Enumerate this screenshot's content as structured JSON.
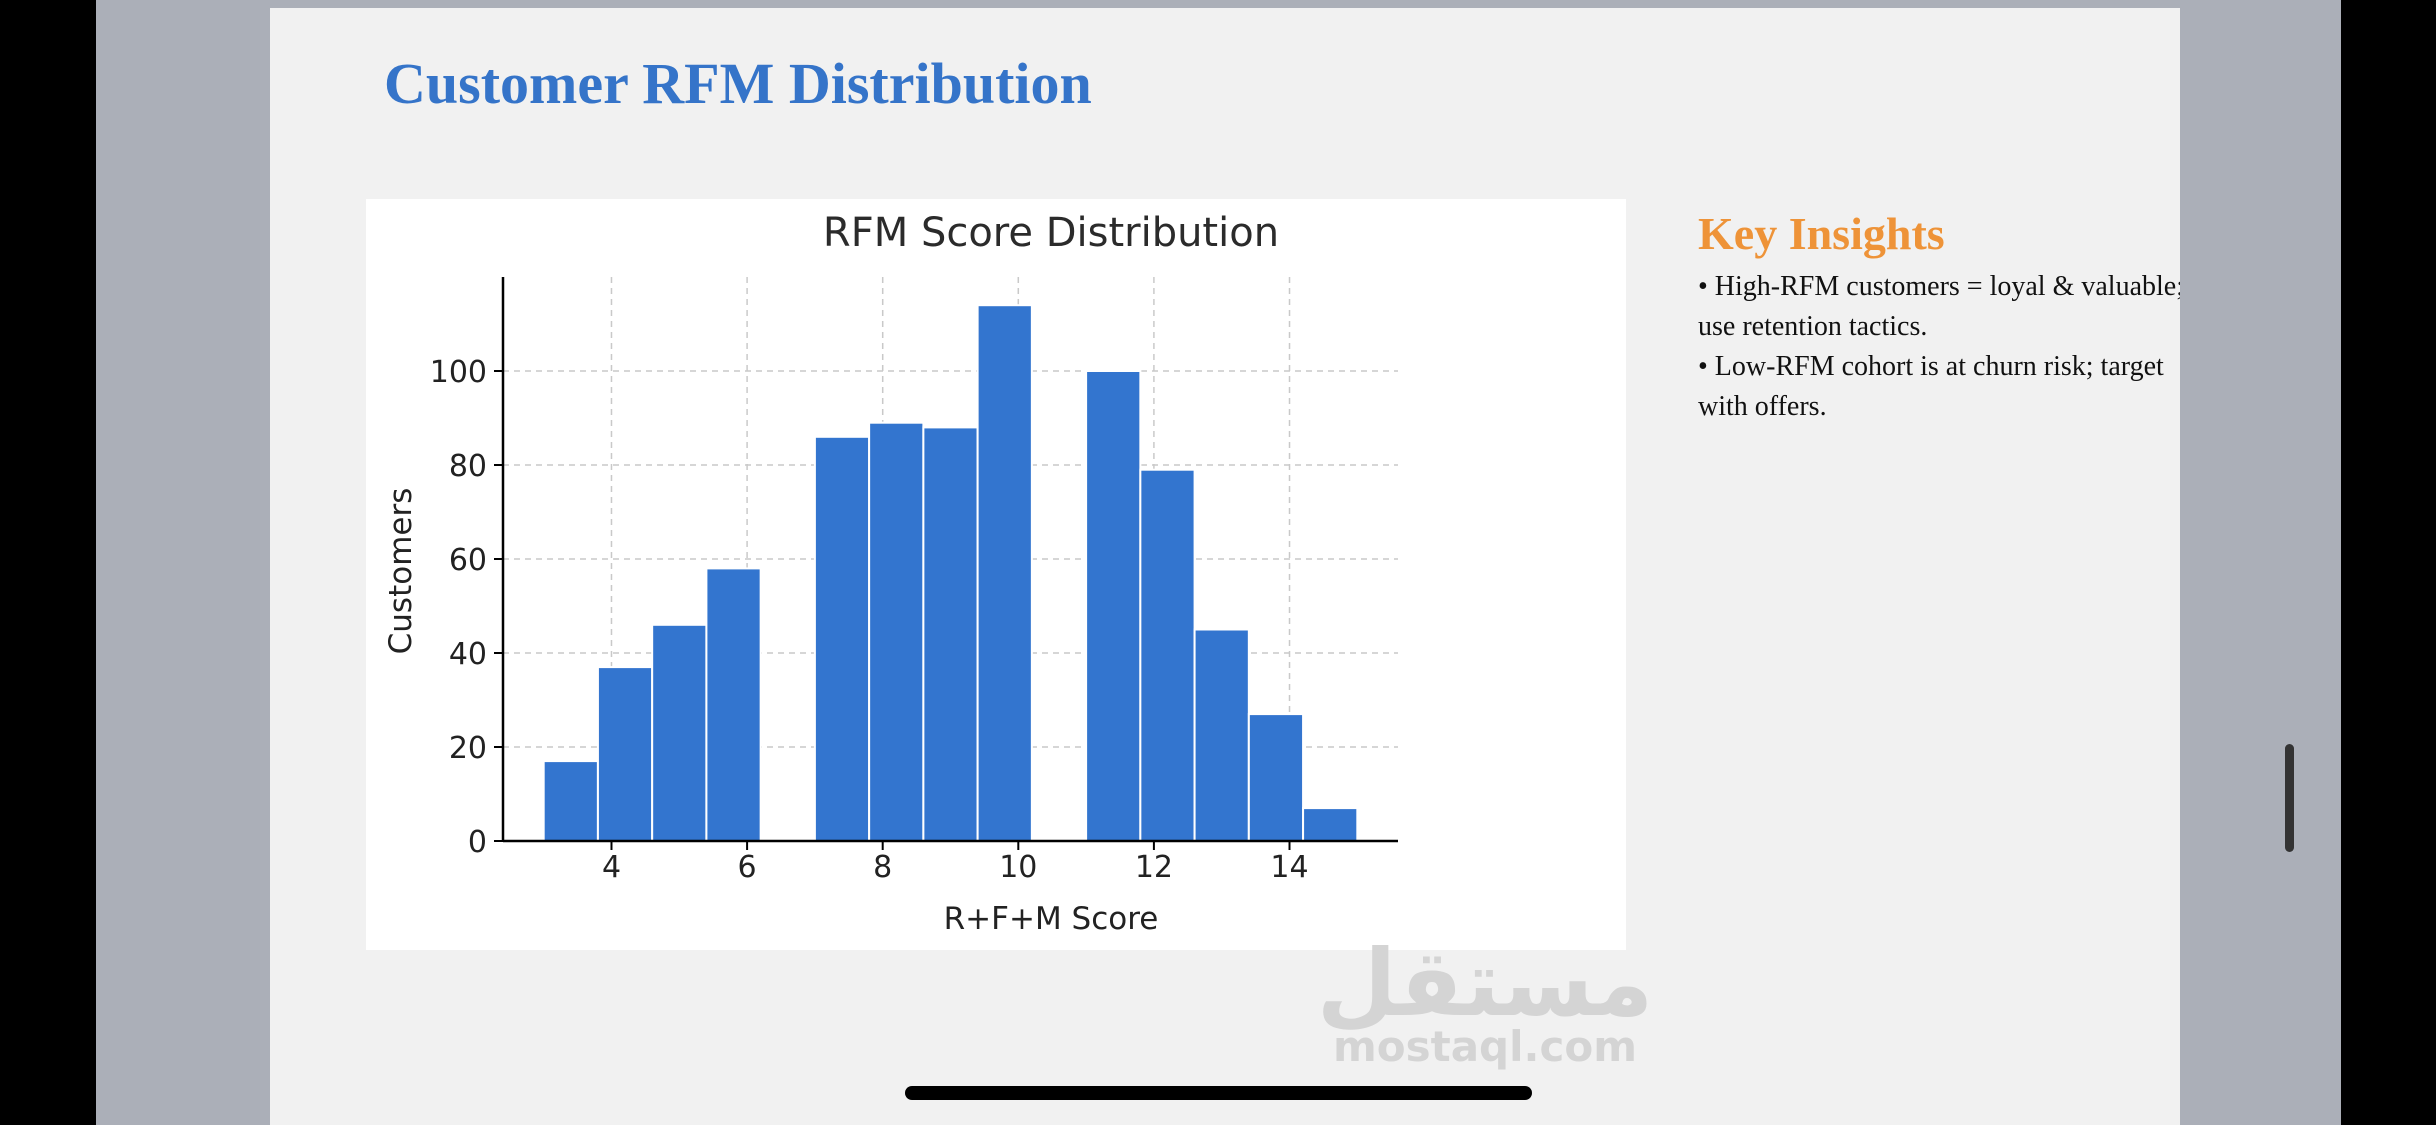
{
  "slide": {
    "title": "Customer RFM Distribution"
  },
  "insights": {
    "title": "Key Insights",
    "items": [
      "• High-RFM customers = loyal & valuable; use retention tactics.",
      "• Low-RFM cohort is at churn risk; target with offers."
    ]
  },
  "watermark": {
    "arabic": "مستقل",
    "latin": "mostaql.com"
  },
  "colors": {
    "accent_blue": "#3574c9",
    "insight_orange": "#ee9338",
    "bar_fill": "#3375cf"
  },
  "chart_data": {
    "type": "bar",
    "title": "RFM Score Distribution",
    "xlabel": "R+F+M Score",
    "ylabel": "Customers",
    "bins": [
      {
        "x0": 3.0,
        "x1": 3.8,
        "value": 17
      },
      {
        "x0": 3.8,
        "x1": 4.6,
        "value": 37
      },
      {
        "x0": 4.6,
        "x1": 5.4,
        "value": 46
      },
      {
        "x0": 5.4,
        "x1": 6.2,
        "value": 58
      },
      {
        "x0": 7.0,
        "x1": 7.8,
        "value": 86
      },
      {
        "x0": 7.8,
        "x1": 8.6,
        "value": 89
      },
      {
        "x0": 8.6,
        "x1": 9.4,
        "value": 88
      },
      {
        "x0": 9.4,
        "x1": 10.2,
        "value": 114
      },
      {
        "x0": 11.0,
        "x1": 11.8,
        "value": 100
      },
      {
        "x0": 11.8,
        "x1": 12.6,
        "value": 79
      },
      {
        "x0": 12.6,
        "x1": 13.4,
        "value": 45
      },
      {
        "x0": 13.4,
        "x1": 14.2,
        "value": 27
      },
      {
        "x0": 14.2,
        "x1": 15.0,
        "value": 7
      }
    ],
    "xlim": [
      2.4,
      15.6
    ],
    "ylim": [
      0,
      120
    ],
    "xticks": [
      4,
      6,
      8,
      10,
      12,
      14
    ],
    "yticks": [
      0,
      20,
      40,
      60,
      80,
      100
    ],
    "grid": true,
    "legend": "none"
  }
}
